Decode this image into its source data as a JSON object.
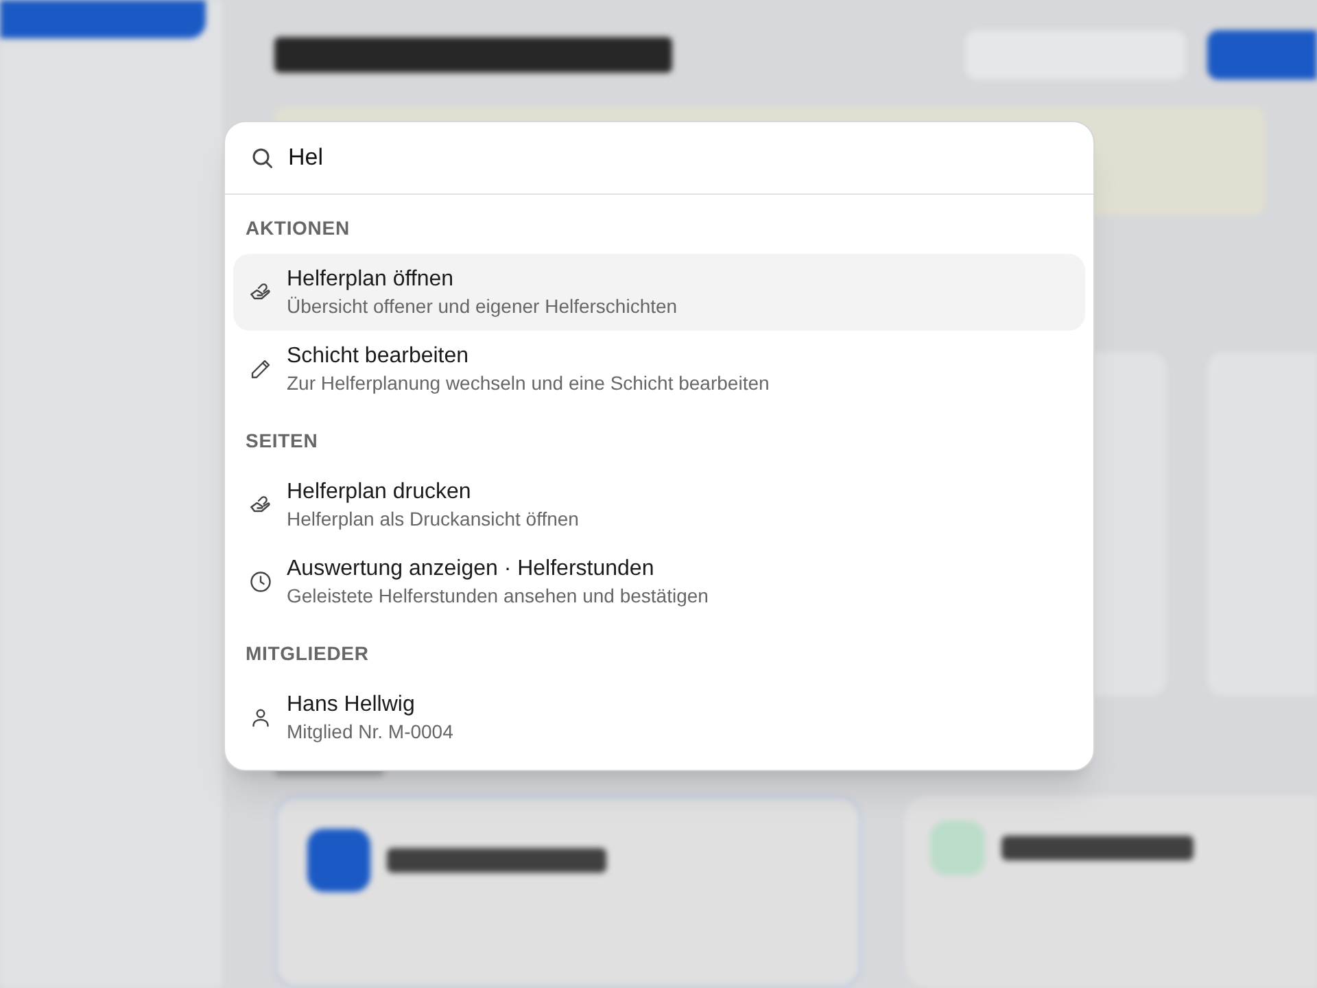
{
  "command_palette": {
    "query": "Hel",
    "groups": [
      {
        "title": "AKTIONEN",
        "items": [
          {
            "kind": "hand",
            "title": "Helferplan öffnen",
            "subtitle": "Übersicht offener und eigener Helferschichten",
            "selected": true
          },
          {
            "kind": "pencil",
            "title": "Schicht bearbeiten",
            "subtitle": "Zur Helferplanung wechseln und eine Schicht bearbeiten",
            "selected": false
          }
        ]
      },
      {
        "title": "SEITEN",
        "items": [
          {
            "kind": "hand",
            "title": "Helferplan drucken",
            "subtitle": "Helferplan als Druckansicht öffnen",
            "selected": false
          },
          {
            "kind": "clock",
            "title": "Auswertung anzeigen · Helferstunden",
            "subtitle": "Geleistete Helferstunden ansehen und bestätigen",
            "selected": false
          }
        ]
      },
      {
        "title": "MITGLIEDER",
        "items": [
          {
            "kind": "person",
            "title": "Hans Hellwig",
            "subtitle": "Mitglied Nr. M-0004",
            "selected": false
          }
        ]
      }
    ]
  }
}
